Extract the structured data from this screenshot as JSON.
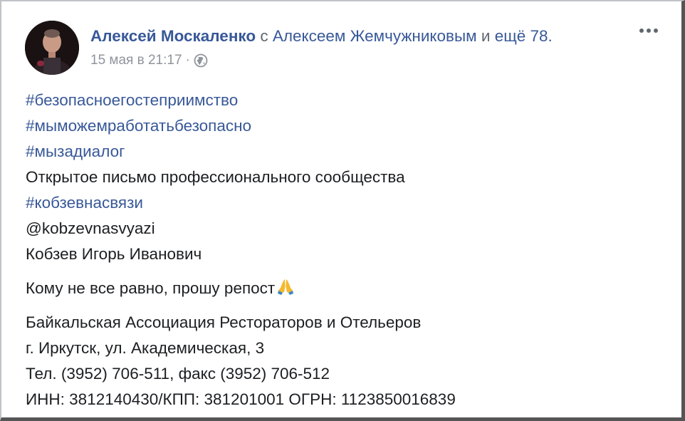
{
  "post": {
    "author": "Алексей Москаленко",
    "with_text": "с",
    "tagged_person": "Алексеем Жемчужниковым",
    "and_text": "и",
    "others": "ещё 78.",
    "timestamp": "15 мая в 21:17",
    "separator": "·",
    "privacy_icon": "globe-icon",
    "more_icon": "more-options-icon",
    "lines": {
      "hashtag1": "#безопасноегостеприимство",
      "hashtag2": "#мыможемработатьбезопасно",
      "hashtag3": "#мызадиалог",
      "text1": "Открытое письмо профессионального сообщества",
      "hashtag4": "#кобзевнасвязи",
      "mention": "@kobzevnasvyazi",
      "name": "Кобзев Игорь Иванович",
      "repost": "Кому не все равно, прошу репост",
      "org": "Байкальская Ассоциация Рестораторов и Отельеров",
      "address": "г. Иркутск, ул. Академическая, 3",
      "phone": "Тел. (3952) 706-511, факс (3952) 706-512",
      "ids": "ИНН: 3812140430/КПП: 381201001 ОГРН: 1123850016839"
    },
    "emoji_icon": "praying-hands-icon"
  },
  "colors": {
    "link": "#385898",
    "meta": "#90949c",
    "text": "#1c1e21"
  }
}
